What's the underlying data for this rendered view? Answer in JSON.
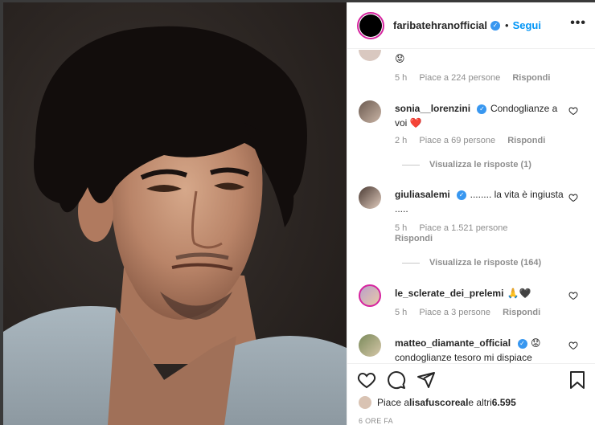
{
  "post": {
    "username": "faribatehranofficial",
    "follow_label": "Segui",
    "more_label": "•••",
    "verified_mark": "✓"
  },
  "comments": [
    {
      "user": "",
      "text": "😟",
      "time": "5 h",
      "likes": "Piace a 224 persone",
      "reply": "Rispondi"
    },
    {
      "user": "sonia__lorenzini",
      "text": "Condoglianze a voi ❤️",
      "time": "2 h",
      "likes": "Piace a 69 persone",
      "reply": "Rispondi",
      "view_replies": "Visualizza le risposte (1)"
    },
    {
      "user": "giuliasalemi",
      "text": "........ la vita è ingiusta .....",
      "time": "5 h",
      "likes": "Piace a 1.521 persone",
      "reply": "Rispondi",
      "view_replies": "Visualizza le risposte (164)"
    },
    {
      "user": "le_sclerate_dei_prelemi",
      "text": "🙏🖤",
      "time": "5 h",
      "likes": "Piace a 3 persone",
      "reply": "Rispondi"
    },
    {
      "user": "matteo_diamante_official",
      "text_a": "😟",
      "text_b": "condoglianze tesoro mi dispiace"
    }
  ],
  "footer": {
    "likes_prefix": "Piace a ",
    "likes_user": "lisafuscoreal",
    "likes_mid": " e altri ",
    "likes_count": "6.595",
    "time": "6 ORE FA"
  },
  "icons": [
    "heart-icon",
    "comment-icon",
    "share-icon",
    "bookmark-icon",
    "more-icon",
    "verified-badge-icon"
  ],
  "colors": {
    "accent": "#0095f6",
    "verified": "#3897f0",
    "muted": "#8e8e8e"
  }
}
